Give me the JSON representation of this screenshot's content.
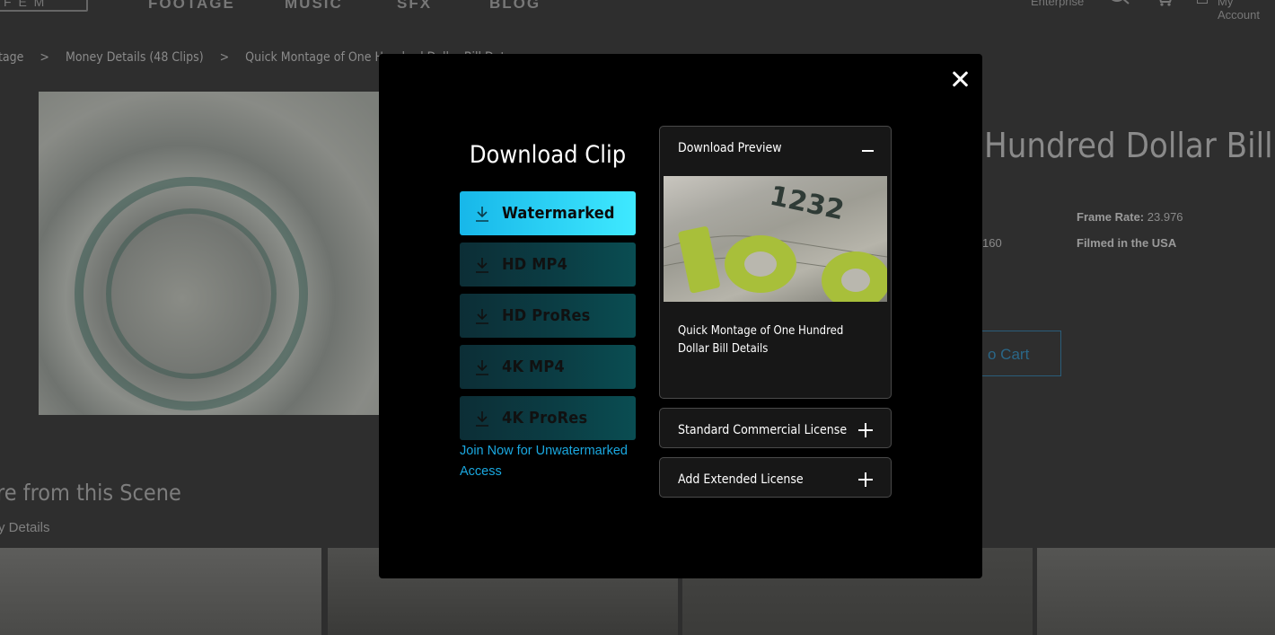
{
  "background": {
    "logo_text": "F E M",
    "nav": [
      "FOOTAGE",
      "MUSIC",
      "SFX",
      "BLOG"
    ],
    "nav_right": {
      "enterprise": "Enterprise",
      "account": "My Account"
    },
    "breadcrumbs": [
      "tage",
      ">",
      "Money Details (48 Clips)",
      ">",
      "Quick Montage of One Hundred Dollar Bill Det"
    ],
    "clip_title": "Hundred Dollar Bill Det",
    "meta": {
      "frame_rate_label": "Frame Rate:",
      "frame_rate_value": "23.976",
      "resolution_fragment": "160",
      "filmed_in": "Filmed in the USA"
    },
    "cart_label": "o Cart",
    "scene_title": "re from this Scene",
    "scene_sub": "y Details"
  },
  "modal": {
    "title": "Download Clip",
    "options": [
      {
        "label": "Watermarked",
        "active": true
      },
      {
        "label": "HD MP4",
        "active": false
      },
      {
        "label": "HD ProRes",
        "active": false
      },
      {
        "label": "4K MP4",
        "active": false
      },
      {
        "label": "4K ProRes",
        "active": false
      }
    ],
    "join_link": "Join Now for Unwatermarked Access",
    "preview_panel": {
      "heading": "Download Preview",
      "description": "Quick Montage of One Hundred Dollar Bill Details",
      "image_digits": "1232"
    },
    "license_panels": [
      {
        "heading": "Standard Commercial License"
      },
      {
        "heading": "Add Extended License"
      }
    ]
  },
  "colors": {
    "accent": "#1aa8e0",
    "active_gradient_start": "#17b7e9",
    "active_gradient_end": "#3fe9ff",
    "modal_bg": "#000000",
    "overlay_bg": "#2e2e2e"
  },
  "icons": {
    "close": "close-icon",
    "download": "download-icon",
    "collapse": "minus-icon",
    "expand": "plus-icon"
  }
}
